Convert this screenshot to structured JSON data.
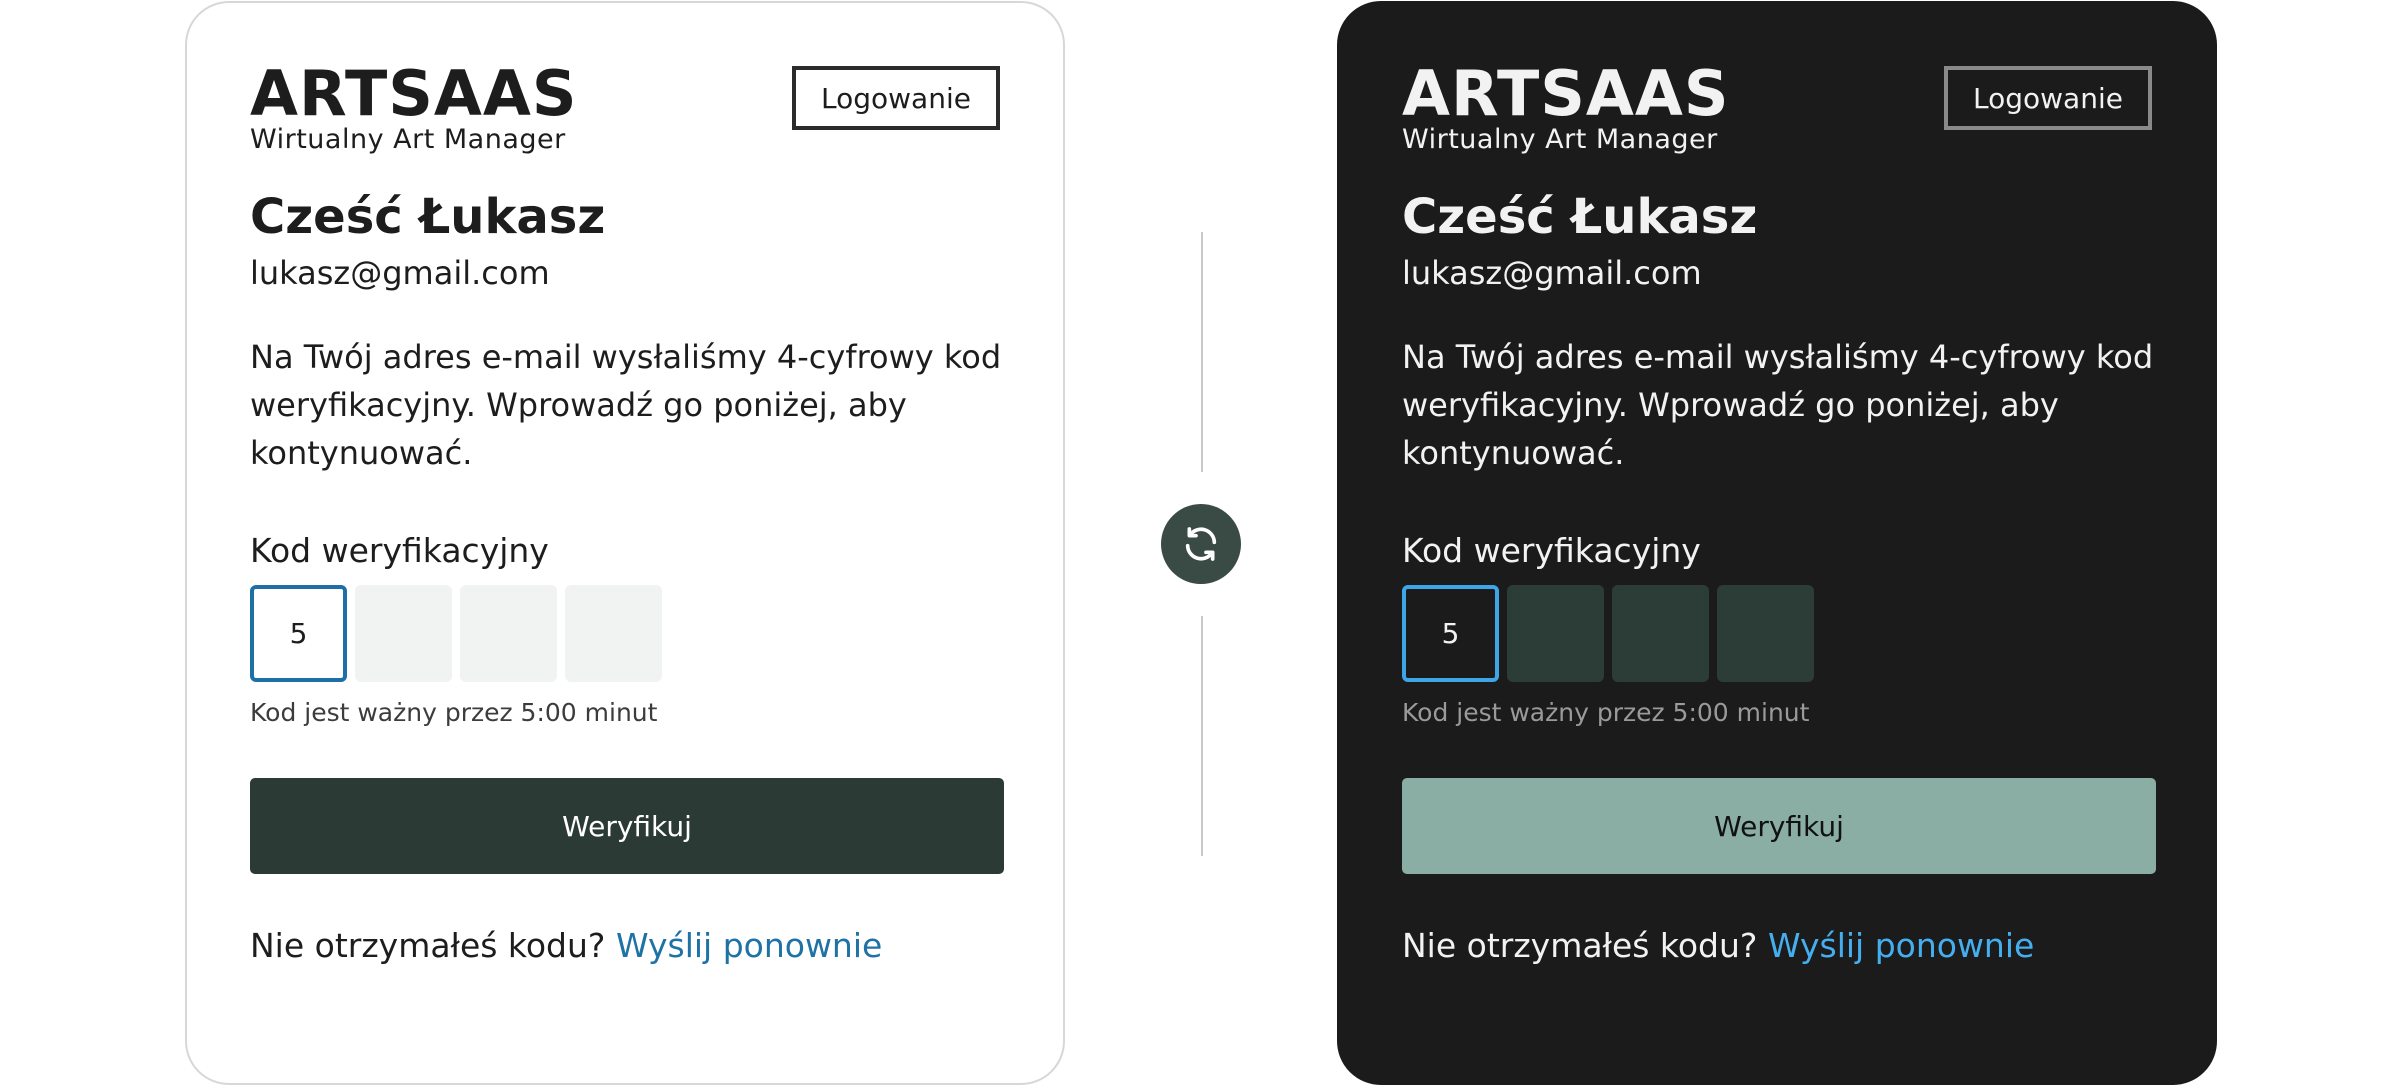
{
  "brand": {
    "name": "ARTSAAS",
    "subtitle": "Wirtualny Art Manager"
  },
  "header": {
    "login_label": "Logowanie"
  },
  "greeting": "Cześć Łukasz",
  "email": "lukasz@gmail.com",
  "message": "Na Twój adres e-mail wysłaliśmy 4-cyfrowy kod weryfikacyjny. Wprowadź go poniżej, aby kontynuować.",
  "code": {
    "label": "Kod weryfikacyjny",
    "digits": [
      "5",
      "",
      "",
      ""
    ],
    "hint": "Kod jest ważny przez 5:00 minut"
  },
  "verify_label": "Weryfikuj",
  "resend": {
    "prompt": "Nie otrzymałeś kodu?",
    "link": "Wyślij ponownie"
  },
  "themes": {
    "light": {
      "background": "#ffffff",
      "accent": "#2c3a35",
      "link": "#1f72a6",
      "focus": "#1e6fa8"
    },
    "dark": {
      "background": "#1b1b1b",
      "accent": "#8aaea4",
      "link": "#45aeee",
      "focus": "#3ea6e6"
    }
  },
  "swap_icon": "refresh-icon"
}
